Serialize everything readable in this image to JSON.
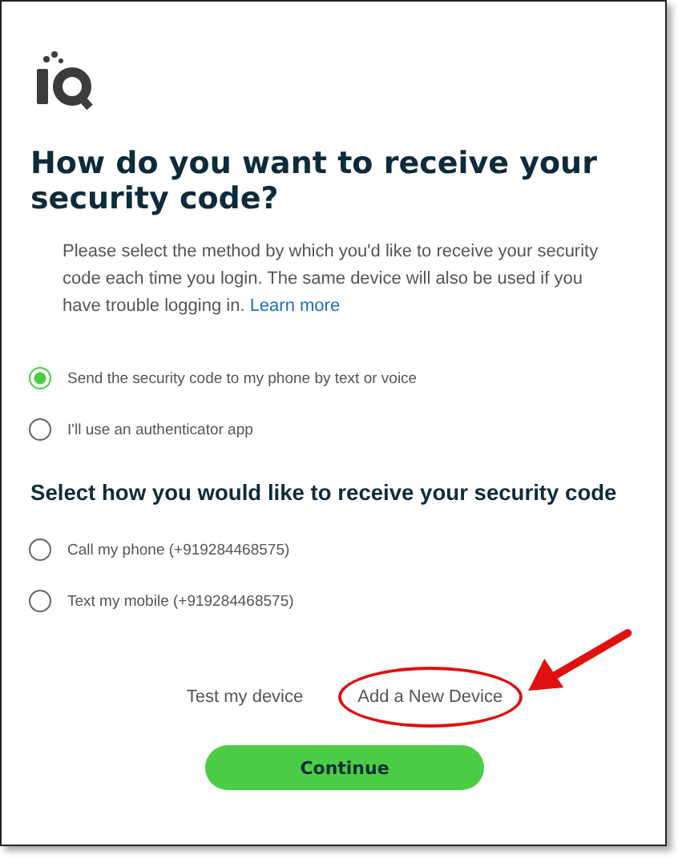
{
  "heading": "How do you want to receive your security code?",
  "intro": {
    "text": "Please select the method by which you'd like to receive your security code each time you login. The same device will also be used if you have trouble logging in.",
    "link": "Learn more"
  },
  "method_options": [
    {
      "label": "Send the security code to my phone by text or voice",
      "selected": true
    },
    {
      "label": "I'll use an authenticator app",
      "selected": false
    }
  ],
  "delivery_heading": "Select how you would like to receive your security code",
  "delivery_options": [
    {
      "label": "Call my phone (+919284468575)",
      "selected": false
    },
    {
      "label": "Text my mobile (+919284468575)",
      "selected": false
    }
  ],
  "links": [
    {
      "label": "Test my device",
      "circled": false
    },
    {
      "label": "Add a New Device",
      "circled": true
    }
  ],
  "continue_button": "Continue"
}
